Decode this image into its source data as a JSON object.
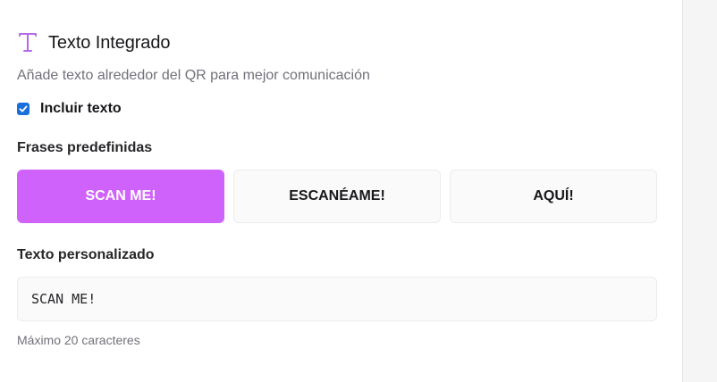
{
  "section": {
    "title": "Texto Integrado",
    "icon": "text-icon",
    "subtitle": "Añade texto alrededor del QR para mejor comunicación"
  },
  "include_text": {
    "label": "Incluir texto",
    "checked": true
  },
  "presets": {
    "label": "Frases predefinidas",
    "items": [
      {
        "label": "SCAN ME!",
        "selected": true
      },
      {
        "label": "ESCANÉAME!",
        "selected": false
      },
      {
        "label": "AQUÍ!",
        "selected": false
      }
    ]
  },
  "custom_text": {
    "label": "Texto personalizado",
    "value": "SCAN ME!",
    "hint": "Máximo 20 caracteres"
  },
  "colors": {
    "accent": "#d062fc",
    "checkbox": "#1a6fdb"
  }
}
